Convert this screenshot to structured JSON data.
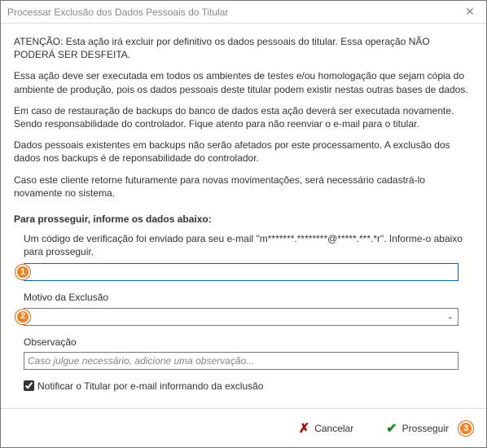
{
  "titlebar": {
    "title": "Processar Exclusão dos Dados Pessoais do Titular"
  },
  "warning": {
    "p1": "ATENÇÃO: Esta ação irá excluir por definitivo os dados pessoais do titular. Essa operação NÃO PODERÁ SER DESFEITA.",
    "p2": "Essa ação deve ser executada em todos os ambientes de testes e/ou homologação que sejam cópia do ambiente de produção, pois os dados pessoais deste titular podem existir nestas outras bases de dados.",
    "p3": "Em caso de restauração de backups do banco de dados esta ação deverá ser executada novamente. Sendo responsabilidade do controlador. Fique atento para não reenviar o e-mail para o titular.",
    "p4": "Dados pessoais existentes em backups não serão afetados por este processamento. A exclusão dos dados nos backups é de reponsabilidade do controlador.",
    "p5": "Caso este cliente retorne futuramente para novas movimentações, será necessário cadastrá-lo novamente no sistema."
  },
  "form": {
    "heading": "Para prosseguir, informe os dados abaixo:",
    "codePrompt": "Um código de verificação foi enviado para seu e-mail \"m*******.********@*****.***.*r\". Informe-o abaixo para prosseguir.",
    "codeValue": "",
    "reasonLabel": "Motivo da Exclusão",
    "reasonValue": "",
    "obsLabel": "Observação",
    "obsPlaceholder": "Caso julgue necessário, adicione uma observação...",
    "obsValue": "",
    "notifyLabel": "Notificar o Titular por e-mail informando da exclusão",
    "notifyChecked": true
  },
  "badges": {
    "b1": "1",
    "b2": "2",
    "b3": "3"
  },
  "buttons": {
    "cancel": "Cancelar",
    "proceed": "Prosseguir"
  }
}
